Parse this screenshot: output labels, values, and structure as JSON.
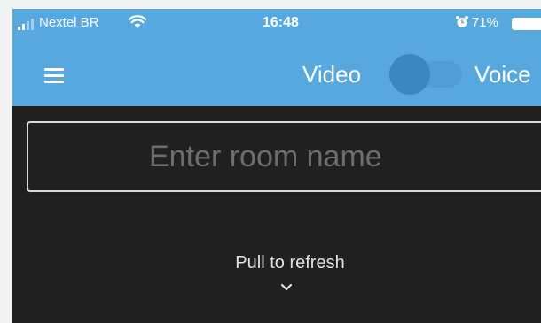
{
  "status_bar": {
    "carrier": "Nextel BR",
    "time": "16:48",
    "battery_percent": "71%",
    "signal_icon": "signal-bars-icon",
    "wifi_icon": "wifi-icon",
    "alarm_icon": "alarm-icon",
    "battery_icon": "battery-icon"
  },
  "toolbar": {
    "menu_icon": "hamburger-menu-icon",
    "mode_left_label": "Video",
    "mode_right_label": "Voice",
    "mode_toggle_on": false
  },
  "room": {
    "placeholder": "Enter room name",
    "value": ""
  },
  "pull_to_refresh": {
    "label": "Pull to refresh",
    "icon": "chevron-down-icon"
  },
  "colors": {
    "app_bar": "#56a8df",
    "background": "#202020",
    "toggle_thumb": "#3b87c2"
  }
}
